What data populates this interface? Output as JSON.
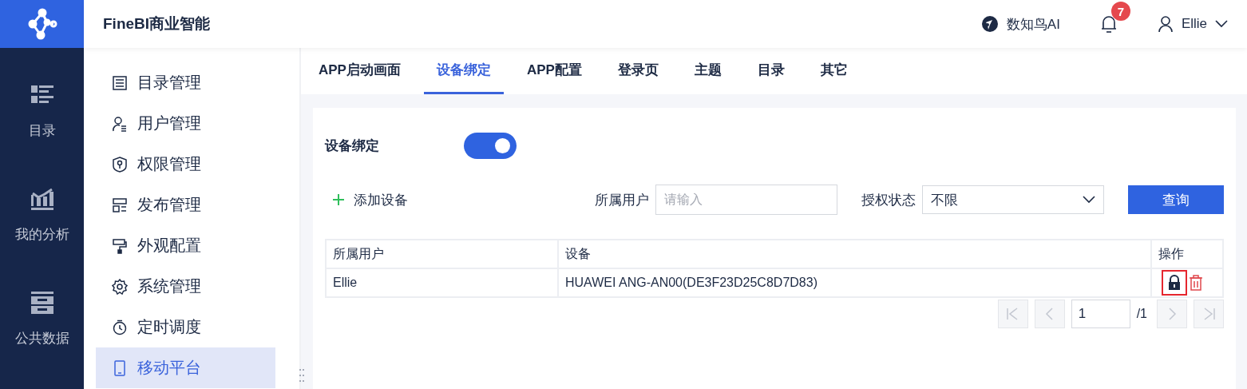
{
  "header": {
    "product_title": "FineBI商业智能",
    "ai_link": "数知鸟AI",
    "notification_count": "7",
    "user_name": "Ellie"
  },
  "rail": [
    {
      "label": "目录",
      "selected": false
    },
    {
      "label": "我的分析",
      "selected": false
    },
    {
      "label": "公共数据",
      "selected": false
    }
  ],
  "sidebar": {
    "items": [
      {
        "label": "目录管理",
        "selected": false
      },
      {
        "label": "用户管理",
        "selected": false
      },
      {
        "label": "权限管理",
        "selected": false
      },
      {
        "label": "发布管理",
        "selected": false
      },
      {
        "label": "外观配置",
        "selected": false
      },
      {
        "label": "系统管理",
        "selected": false
      },
      {
        "label": "定时调度",
        "selected": false
      },
      {
        "label": "移动平台",
        "selected": true
      }
    ]
  },
  "tabs": [
    {
      "label": "APP启动画面",
      "selected": false
    },
    {
      "label": "设备绑定",
      "selected": true
    },
    {
      "label": "APP配置",
      "selected": false
    },
    {
      "label": "登录页",
      "selected": false
    },
    {
      "label": "主题",
      "selected": false
    },
    {
      "label": "目录",
      "selected": false
    },
    {
      "label": "其它",
      "selected": false
    }
  ],
  "binding": {
    "label": "设备绑定",
    "on": true
  },
  "toolbar": {
    "add_button": "添加设备",
    "user_filter": {
      "label": "所属用户",
      "placeholder": "请输入"
    },
    "status_filter": {
      "label": "授权状态",
      "value": "不限"
    },
    "query_button": "查询"
  },
  "table": {
    "columns": [
      "所属用户",
      "设备",
      "操作"
    ],
    "rows": [
      {
        "user": "Ellie",
        "device": "HUAWEI ANG-AN00(DE3F23D25C8D7D83)",
        "locked": true
      }
    ]
  },
  "pagination": {
    "page": "1",
    "total": "/1"
  }
}
